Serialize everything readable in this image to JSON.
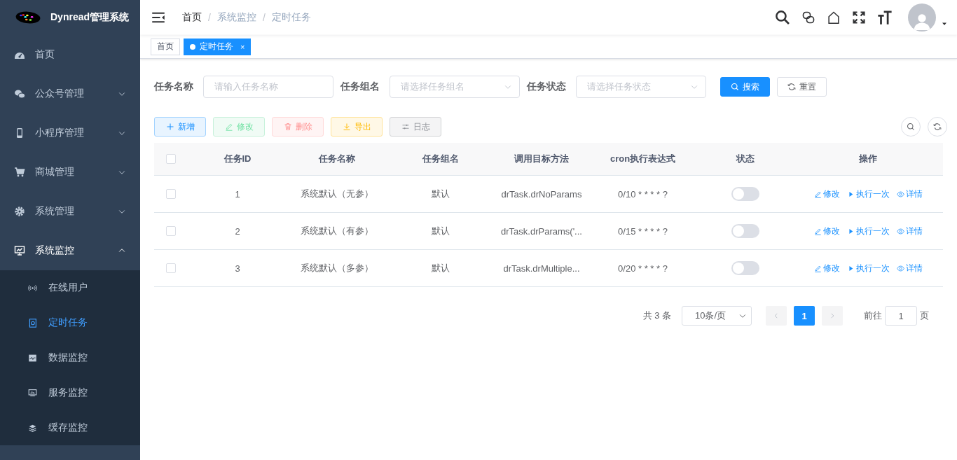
{
  "app": {
    "title": "Dynread管理系统"
  },
  "sidebar": {
    "items": [
      {
        "label": "首页",
        "kind": "link"
      },
      {
        "label": "公众号管理",
        "kind": "submenu",
        "expanded": false
      },
      {
        "label": "小程序管理",
        "kind": "submenu",
        "expanded": false
      },
      {
        "label": "商城管理",
        "kind": "submenu",
        "expanded": false
      },
      {
        "label": "系统管理",
        "kind": "submenu",
        "expanded": false
      },
      {
        "label": "系统监控",
        "kind": "submenu",
        "expanded": true,
        "children": [
          {
            "label": "在线用户",
            "selected": false
          },
          {
            "label": "定时任务",
            "selected": true
          },
          {
            "label": "数据监控",
            "selected": false
          },
          {
            "label": "服务监控",
            "selected": false
          },
          {
            "label": "缓存监控",
            "selected": false
          }
        ]
      }
    ]
  },
  "breadcrumb": [
    {
      "label": "首页"
    },
    {
      "separator": "/",
      "label": "系统监控"
    },
    {
      "separator": "/",
      "label": "定时任务"
    }
  ],
  "tags": [
    {
      "label": "首页",
      "selected": false
    },
    {
      "label": "定时任务",
      "selected": true,
      "close": "×"
    }
  ],
  "search": {
    "fields": [
      {
        "label": "任务名称",
        "kind": "input",
        "placeholder": "请输入任务名称"
      },
      {
        "label": "任务组名",
        "kind": "select",
        "placeholder": "请选择任务组名"
      },
      {
        "label": "任务状态",
        "kind": "select",
        "placeholder": "请选择任务状态"
      }
    ],
    "buttons": [
      {
        "label": "搜索",
        "kind": "primary"
      },
      {
        "label": "重置",
        "kind": "default"
      }
    ]
  },
  "toolbar": [
    {
      "label": "新增",
      "kind": "add",
      "disabled": false
    },
    {
      "label": "修改",
      "kind": "edit",
      "disabled": true
    },
    {
      "label": "删除",
      "kind": "delete",
      "disabled": true
    },
    {
      "label": "导出",
      "kind": "export",
      "disabled": false
    },
    {
      "label": "日志",
      "kind": "log",
      "disabled": false
    }
  ],
  "table": {
    "header_checked": false,
    "columns": [
      "任务ID",
      "任务名称",
      "任务组名",
      "调用目标方法",
      "cron执行表达式",
      "状态",
      "操作"
    ],
    "rows": [
      {
        "checked": false,
        "id": "1",
        "name": "系统默认（无参）",
        "group": "默认",
        "target": "drTask.drNoParams",
        "cron": "0/10 * * * * ?",
        "on": false,
        "actions": [
          {
            "kind": "edit",
            "label": "修改"
          },
          {
            "kind": "run",
            "label": "执行一次"
          },
          {
            "kind": "view",
            "label": "详情"
          }
        ]
      },
      {
        "checked": false,
        "id": "2",
        "name": "系统默认（有参）",
        "group": "默认",
        "target": "drTask.drParams('...",
        "cron": "0/15 * * * * ?",
        "on": false,
        "actions": [
          {
            "kind": "edit",
            "label": "修改"
          },
          {
            "kind": "run",
            "label": "执行一次"
          },
          {
            "kind": "view",
            "label": "详情"
          }
        ]
      },
      {
        "checked": false,
        "id": "3",
        "name": "系统默认（多参）",
        "group": "默认",
        "target": "drTask.drMultiple...",
        "cron": "0/20 * * * * ?",
        "on": false,
        "actions": [
          {
            "kind": "edit",
            "label": "修改"
          },
          {
            "kind": "run",
            "label": "执行一次"
          },
          {
            "kind": "view",
            "label": "详情"
          }
        ]
      }
    ]
  },
  "pagination": {
    "total": "共 3 条",
    "page_size": "10条/页",
    "pages": [
      {
        "label": "1",
        "selected": true
      }
    ],
    "goto_label": "前往",
    "goto_value": "1",
    "goto_suffix": "页"
  }
}
